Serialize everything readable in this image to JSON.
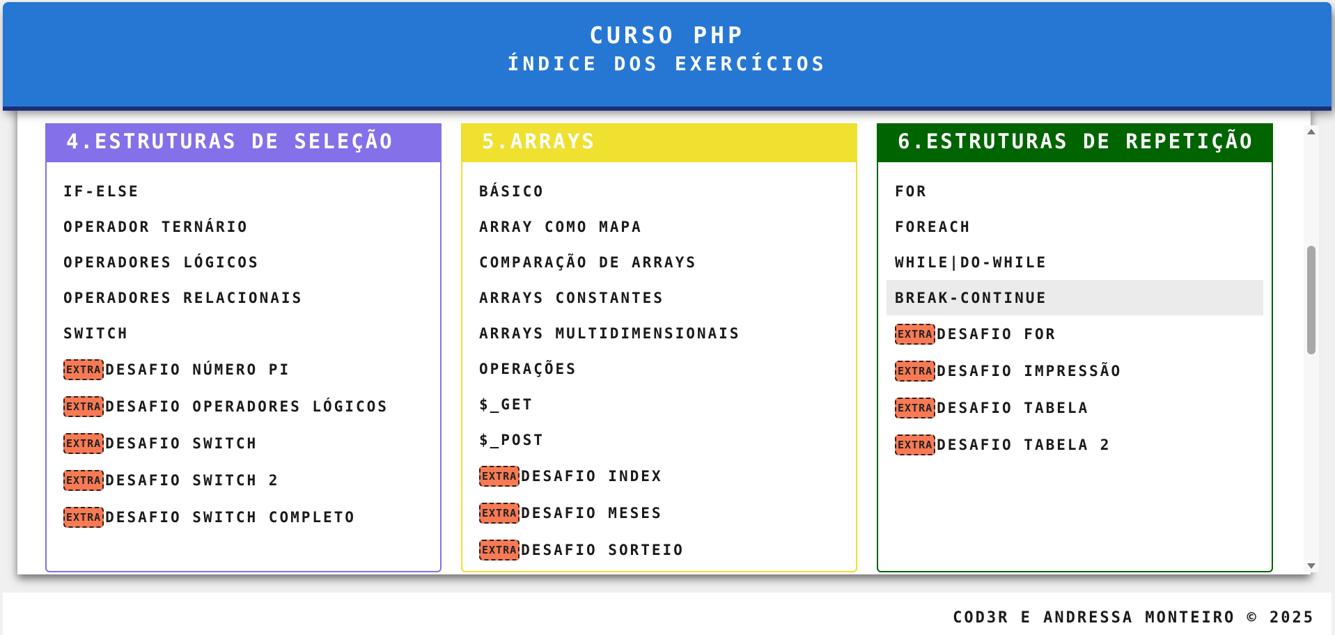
{
  "header": {
    "title": "CURSO PHP",
    "subtitle": "ÍNDICE DOS EXERCÍCIOS"
  },
  "colors": {
    "header_bg": "#2677d4",
    "card_selecao": "#8470e8",
    "card_arrays": "#f0e030",
    "card_repeticao": "#006400",
    "extra_badge": "#f87a55"
  },
  "cards": [
    {
      "title": "4.ESTRUTURAS DE SELEÇÃO",
      "items": [
        {
          "label": "IF-ELSE",
          "extra": ""
        },
        {
          "label": "OPERADOR TERNÁRIO",
          "extra": ""
        },
        {
          "label": "OPERADORES LÓGICOS",
          "extra": ""
        },
        {
          "label": "OPERADORES RELACIONAIS",
          "extra": ""
        },
        {
          "label": "SWITCH",
          "extra": ""
        },
        {
          "label": "DESAFIO NÚMERO PI",
          "extra": "EXTRA"
        },
        {
          "label": "DESAFIO OPERADORES LÓGICOS",
          "extra": "EXTRA"
        },
        {
          "label": "DESAFIO SWITCH",
          "extra": "EXTRA"
        },
        {
          "label": "DESAFIO SWITCH 2",
          "extra": "EXTRA"
        },
        {
          "label": "DESAFIO SWITCH COMPLETO",
          "extra": "EXTRA"
        }
      ]
    },
    {
      "title": "5.ARRAYS",
      "items": [
        {
          "label": "BÁSICO",
          "extra": ""
        },
        {
          "label": "ARRAY COMO MAPA",
          "extra": ""
        },
        {
          "label": "COMPARAÇÃO DE ARRAYS",
          "extra": ""
        },
        {
          "label": "ARRAYS CONSTANTES",
          "extra": ""
        },
        {
          "label": "ARRAYS MULTIDIMENSIONAIS",
          "extra": ""
        },
        {
          "label": "OPERAÇÕES",
          "extra": ""
        },
        {
          "label": "$_GET",
          "extra": ""
        },
        {
          "label": "$_POST",
          "extra": ""
        },
        {
          "label": "DESAFIO INDEX",
          "extra": "EXTRA"
        },
        {
          "label": "DESAFIO MESES",
          "extra": "EXTRA"
        },
        {
          "label": "DESAFIO SORTEIO",
          "extra": "EXTRA"
        }
      ]
    },
    {
      "title": "6.ESTRUTURAS DE REPETIÇÃO",
      "items": [
        {
          "label": "FOR",
          "extra": ""
        },
        {
          "label": "FOREACH",
          "extra": ""
        },
        {
          "label": "WHILE|DO-WHILE",
          "extra": ""
        },
        {
          "label": "BREAK-CONTINUE",
          "extra": ""
        },
        {
          "label": "DESAFIO FOR",
          "extra": "EXTRA"
        },
        {
          "label": "DESAFIO IMPRESSÃO",
          "extra": "EXTRA"
        },
        {
          "label": "DESAFIO TABELA",
          "extra": "EXTRA"
        },
        {
          "label": "DESAFIO TABELA 2",
          "extra": "EXTRA"
        }
      ]
    }
  ],
  "footer": {
    "credit": "COD3R E ANDRESSA MONTEIRO © 2025"
  }
}
